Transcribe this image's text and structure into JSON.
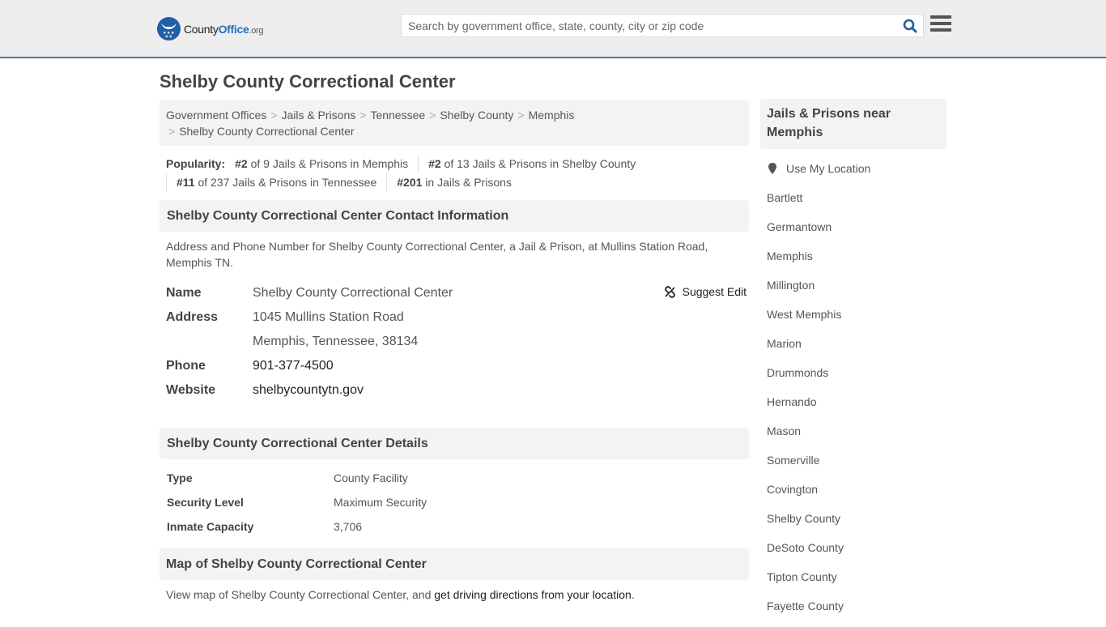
{
  "header": {
    "logo": {
      "county": "County",
      "office": "Office",
      "org": ".org"
    },
    "search": {
      "placeholder": "Search by government office, state, county, city or zip code",
      "value": ""
    },
    "colors": {
      "accent": "#3b7bad",
      "brand": "#1f5fa6"
    }
  },
  "page": {
    "title": "Shelby County Correctional Center"
  },
  "breadcrumb": [
    "Government Offices",
    "Jails & Prisons",
    "Tennessee",
    "Shelby County",
    "Memphis",
    "Shelby County Correctional Center"
  ],
  "popularity": {
    "label": "Popularity:",
    "items": [
      {
        "rank": "#2",
        "text": " of 9 Jails & Prisons in Memphis"
      },
      {
        "rank": "#2",
        "text": " of 13 Jails & Prisons in Shelby County"
      },
      {
        "rank": "#11",
        "text": " of 237 Jails & Prisons in Tennessee"
      },
      {
        "rank": "#201",
        "text": " in Jails & Prisons"
      }
    ]
  },
  "contact": {
    "header": "Shelby County Correctional Center Contact Information",
    "description": "Address and Phone Number for Shelby County Correctional Center, a Jail & Prison, at Mullins Station Road, Memphis TN.",
    "suggest_edit": "Suggest Edit",
    "name_label": "Name",
    "name": "Shelby County Correctional Center",
    "address_label": "Address",
    "address_line1": "1045 Mullins Station Road",
    "address_line2": "Memphis, Tennessee, 38134",
    "phone_label": "Phone",
    "phone": "901-377-4500",
    "website_label": "Website",
    "website": "shelbycountytn.gov"
  },
  "details": {
    "header": "Shelby County Correctional Center Details",
    "rows": [
      {
        "label": "Type",
        "value": "County Facility"
      },
      {
        "label": "Security Level",
        "value": "Maximum Security"
      },
      {
        "label": "Inmate Capacity",
        "value": "3,706"
      }
    ]
  },
  "map": {
    "header": "Map of Shelby County Correctional Center",
    "desc_prefix": "View map of Shelby County Correctional Center, and ",
    "directions_link": "get driving directions from your location",
    "desc_suffix": "."
  },
  "sidebar": {
    "header": "Jails & Prisons near Memphis",
    "use_location": "Use My Location",
    "links": [
      "Bartlett",
      "Germantown",
      "Memphis",
      "Millington",
      "West Memphis",
      "Marion",
      "Drummonds",
      "Hernando",
      "Mason",
      "Somerville",
      "Covington",
      "Shelby County",
      "DeSoto County",
      "Tipton County",
      "Fayette County"
    ]
  }
}
